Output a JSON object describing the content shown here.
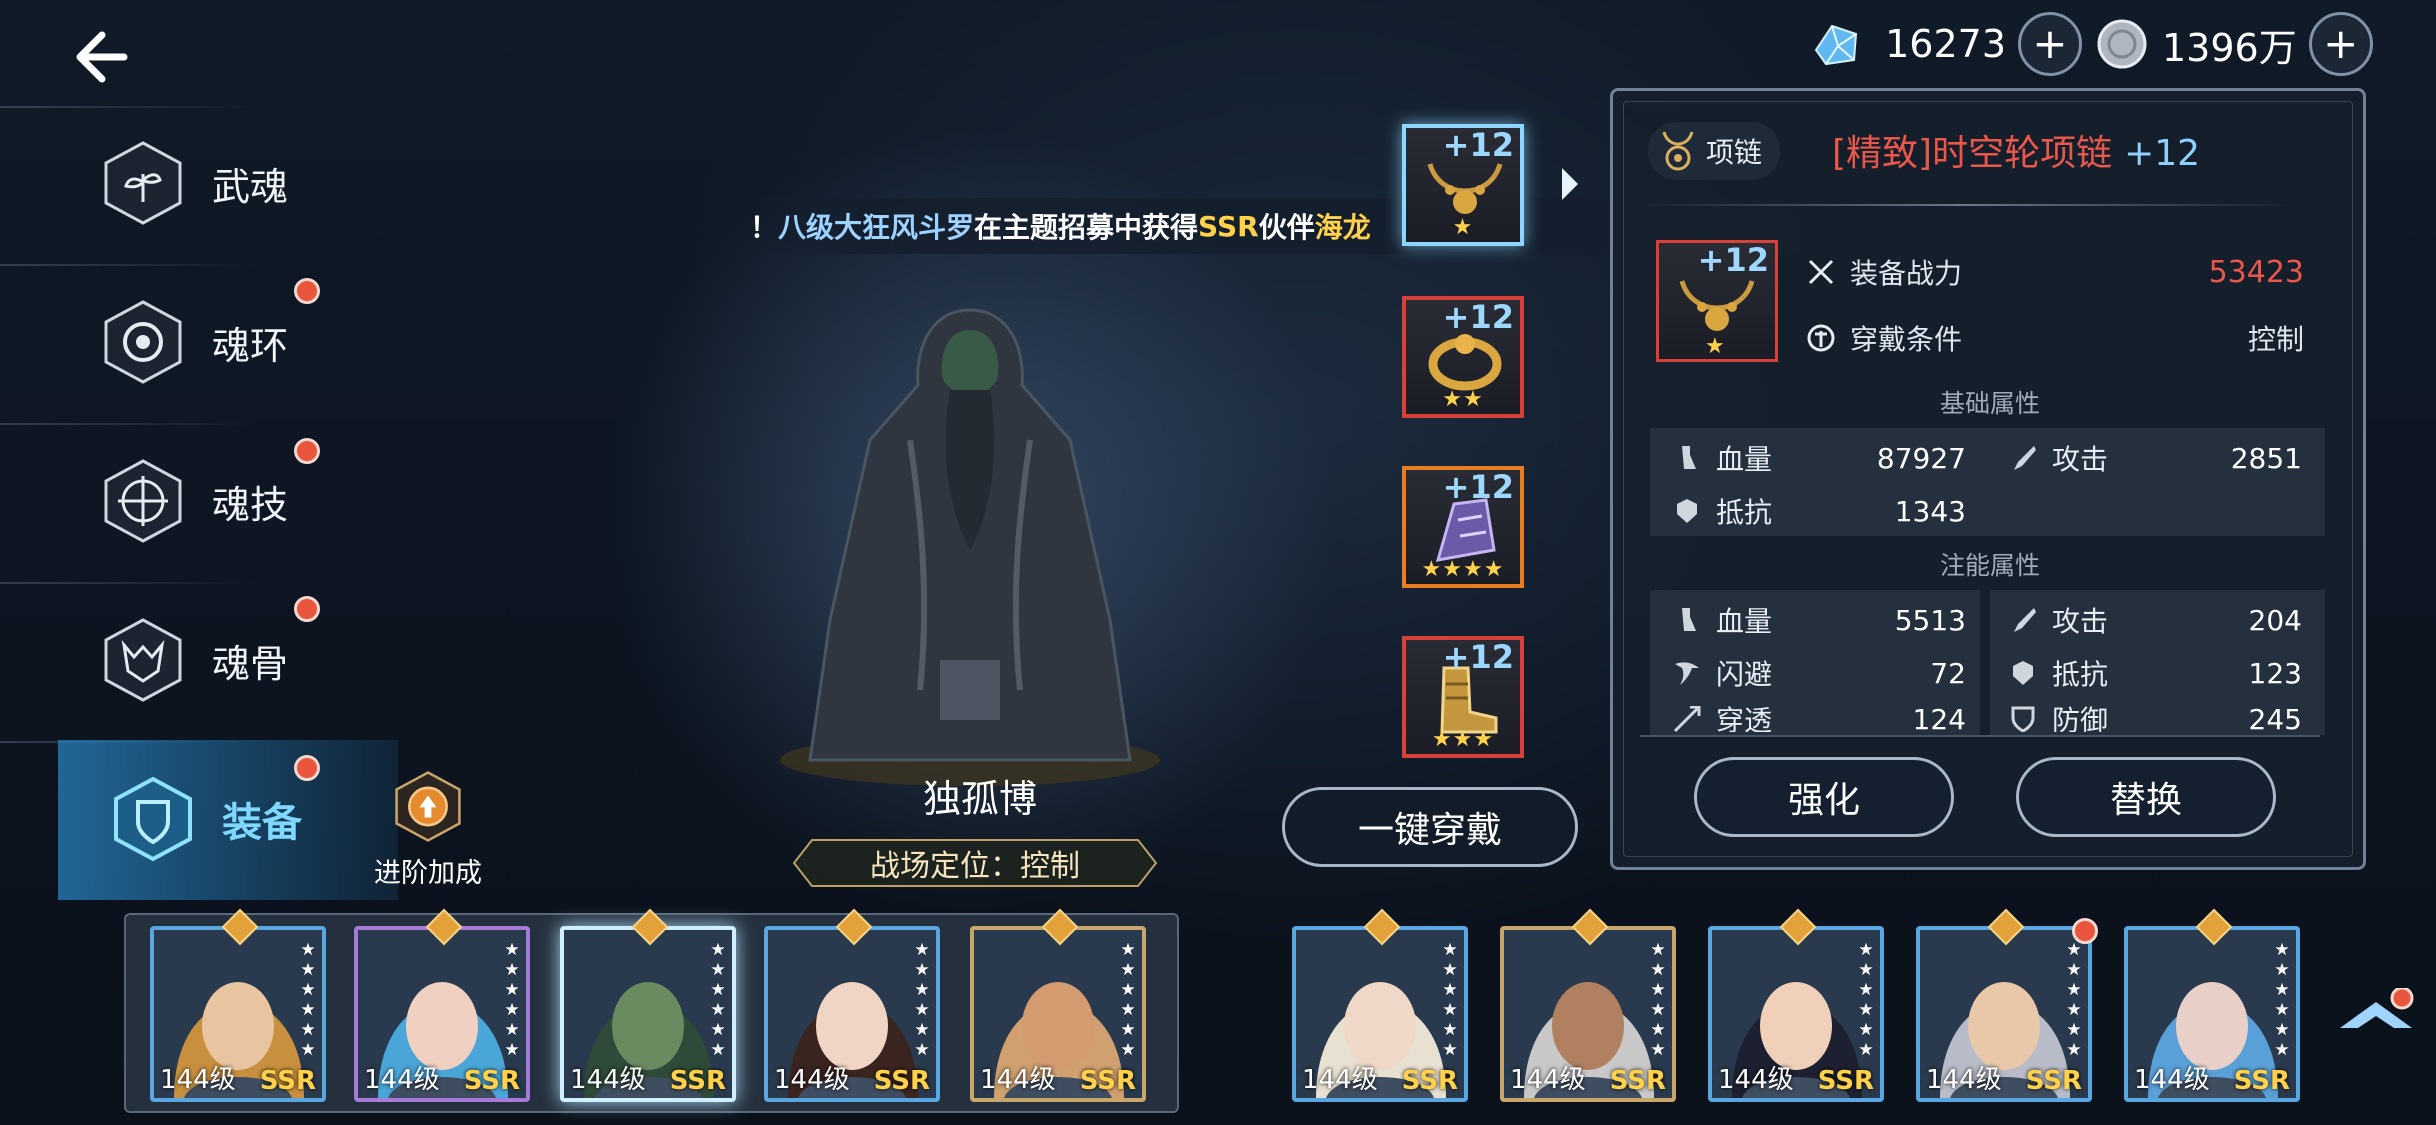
{
  "currency": {
    "diamond": {
      "icon": "diamond-icon",
      "value": "16273"
    },
    "coin": {
      "icon": "silver-coin-icon",
      "value": "1396万"
    },
    "plus": "+"
  },
  "menu": {
    "items": [
      {
        "label": "武魂",
        "icon": "wuhun-icon",
        "badge": false
      },
      {
        "label": "魂环",
        "icon": "soul-ring-icon",
        "badge": true
      },
      {
        "label": "魂技",
        "icon": "soul-skill-icon",
        "badge": true
      },
      {
        "label": "魂骨",
        "icon": "soul-bone-icon",
        "badge": true
      },
      {
        "label": "装备",
        "icon": "equipment-icon",
        "badge": true
      }
    ],
    "advance_label": "进阶加成"
  },
  "broadcast": {
    "prefix": "！",
    "player": "八级大狂风斗罗",
    "mid1": "在主题招募中获得",
    "rarity": "SSR",
    "mid2": "伙伴",
    "partner": "海龙"
  },
  "character": {
    "name": "独孤博",
    "role": "战场定位：控制"
  },
  "equip_slots": [
    {
      "plus": "+12",
      "stars": "★",
      "border": "selected"
    },
    {
      "plus": "+12",
      "stars": "★★",
      "border": "red"
    },
    {
      "plus": "+12",
      "stars": "★★★★",
      "border": "orange"
    },
    {
      "plus": "+12",
      "stars": "★★★",
      "border": "red"
    }
  ],
  "one_key_equip": "一键穿戴",
  "detail": {
    "type_label": "项链",
    "item_name": "[精致]时空轮项链",
    "item_level": "+12",
    "thumb_plus": "+12",
    "thumb_star": "★",
    "power_label": "装备战力",
    "power_value": "53423",
    "condition_label": "穿戴条件",
    "condition_value": "控制",
    "base_title": "基础属性",
    "base_stats": [
      {
        "label": "血量",
        "value": "87927",
        "icon": "blood-icon"
      },
      {
        "label": "攻击",
        "value": "2851",
        "icon": "attack-icon"
      },
      {
        "label": "抵抗",
        "value": "1343",
        "icon": "resist-icon"
      }
    ],
    "inject_title": "注能属性",
    "inject_stats": [
      {
        "label": "血量",
        "value": "5513",
        "icon": "blood-icon"
      },
      {
        "label": "攻击",
        "value": "204",
        "icon": "attack-icon"
      },
      {
        "label": "闪避",
        "value": "72",
        "icon": "dodge-icon"
      },
      {
        "label": "抵抗",
        "value": "123",
        "icon": "resist-icon"
      },
      {
        "label": "穿透",
        "value": "124",
        "icon": "pierce-icon"
      },
      {
        "label": "防御",
        "value": "245",
        "icon": "defense-icon"
      }
    ],
    "enhance_label": "强化",
    "replace_label": "替换"
  },
  "roster": [
    {
      "level": "144级",
      "rarity": "SSR",
      "stars": 6
    },
    {
      "level": "144级",
      "rarity": "SSR",
      "stars": 6
    },
    {
      "level": "144级",
      "rarity": "SSR",
      "stars": 6
    },
    {
      "level": "144级",
      "rarity": "SSR",
      "stars": 6
    },
    {
      "level": "144级",
      "rarity": "SSR",
      "stars": 6
    },
    {
      "level": "144级",
      "rarity": "SSR",
      "stars": 6
    },
    {
      "level": "144级",
      "rarity": "SSR",
      "stars": 6
    },
    {
      "level": "144级",
      "rarity": "SSR",
      "stars": 6
    },
    {
      "level": "144级",
      "rarity": "SSR",
      "stars": 6
    },
    {
      "level": "144级",
      "rarity": "SSR",
      "stars": 6
    }
  ],
  "colors": {
    "accent": "#7fd8ff",
    "badge": "#e9553d",
    "power": "#e9564a",
    "rarity": "#ffd24a"
  }
}
